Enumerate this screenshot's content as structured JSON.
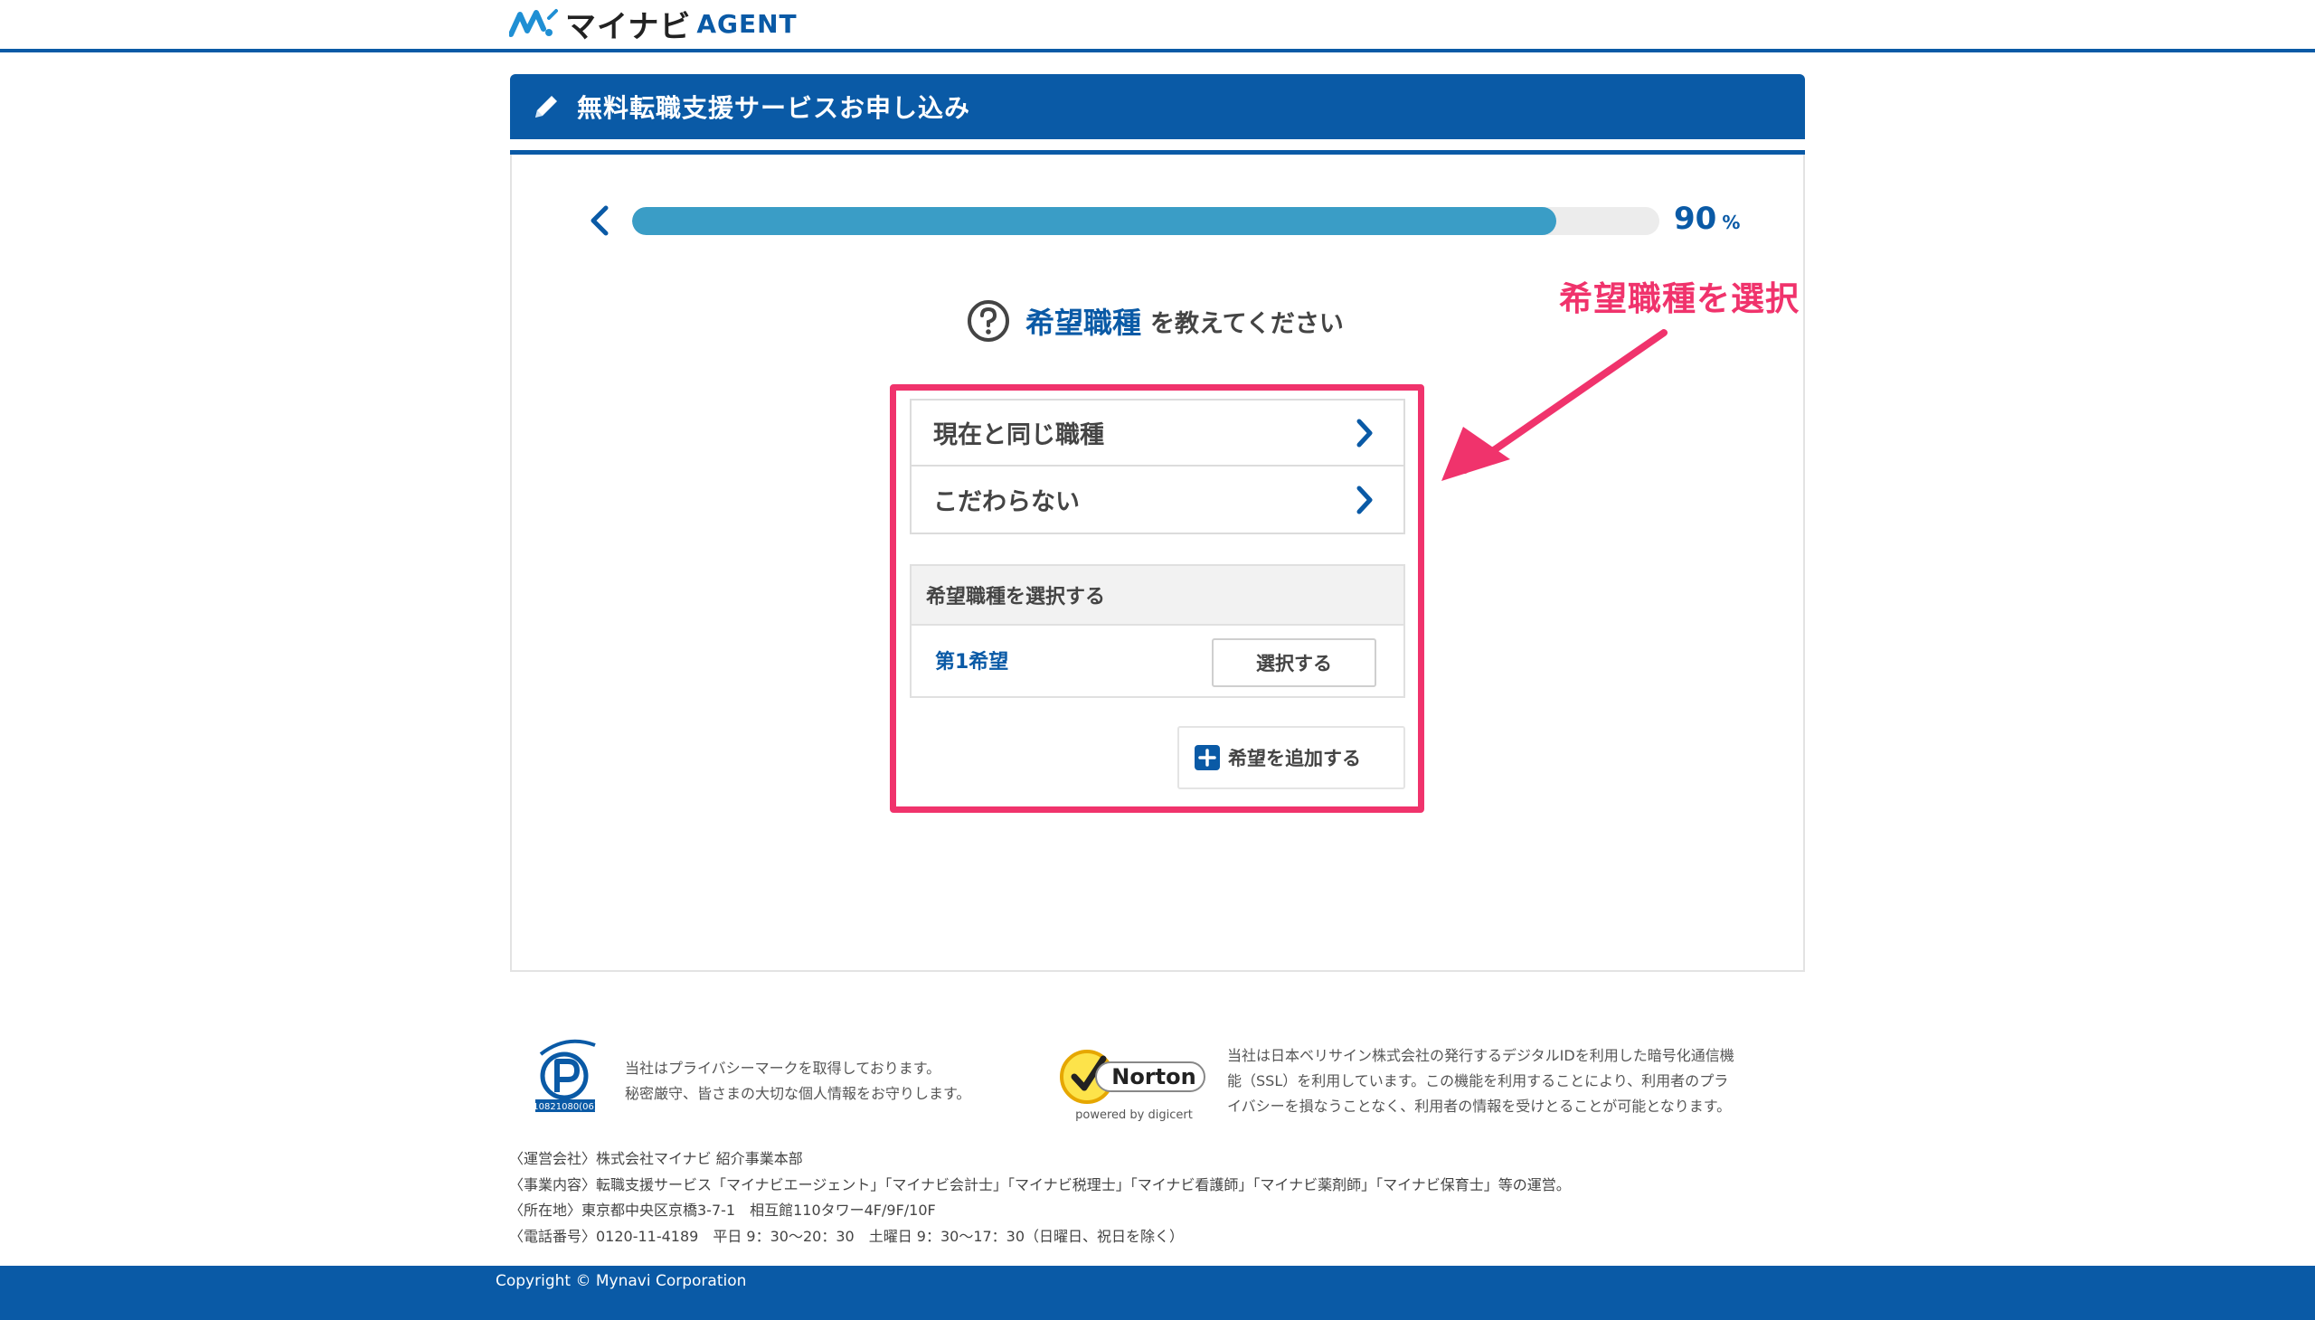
{
  "header": {
    "logo_main": "マイナビ",
    "logo_agent": "AGENT"
  },
  "title_bar": {
    "text": "無料転職支援サービスお申し込み",
    "icon": "pencil-icon"
  },
  "progress": {
    "value_percent": 90,
    "number": "90",
    "unit": "%",
    "back_icon": "chevron-left-icon"
  },
  "question": {
    "icon": "question-circle-icon",
    "highlight": "希望職種",
    "rest": "を教えてください"
  },
  "options": [
    {
      "label": "現在と同じ職種",
      "icon": "chevron-right-icon"
    },
    {
      "label": "こだわらない",
      "icon": "chevron-right-icon"
    }
  ],
  "select_section": {
    "heading": "希望職種を選択する",
    "choice_label": "第1希望",
    "select_button": "選択する",
    "add_button": "希望を追加する",
    "add_icon": "plus-square-icon"
  },
  "annotation": {
    "label": "希望職種を選択",
    "color": "#f0336c"
  },
  "footer": {
    "privacy_text_1": "当社はプライバシーマークを取得しております。",
    "privacy_text_2": "秘密厳守、皆さまの大切な個人情報をお守りします。",
    "privacy_mark_text": "10821080(06)",
    "ssl_text_1": "当社は日本ベリサイン株式会社の発行するデジタルIDを利用した暗号化通信機",
    "ssl_text_2": "能（SSL）を利用しています。この機能を利用することにより、利用者のプラ",
    "ssl_text_3": "イバシーを損なうことなく、利用者の情報を受けとることが可能となります。",
    "norton_brand": "Norton",
    "norton_sub": "powered by digicert",
    "company_lines": [
      "〈運営会社〉株式会社マイナビ 紹介事業本部",
      "〈事業内容〉転職支援サービス「マイナビエージェント」「マイナビ会計士」「マイナビ税理士」「マイナビ看護師」「マイナビ薬剤師」「マイナビ保育士」等の運営。",
      "〈所在地〉東京都中央区京橋3-7-1　相互館110タワー4F/9F/10F",
      "〈電話番号〉0120-11-4189　平日 9：30〜20：30　土曜日 9：30〜17：30（日曜日、祝日を除く）"
    ],
    "copyright": "Copyright © Mynavi Corporation"
  },
  "colors": {
    "brand_blue": "#0a5aa6",
    "progress_fill": "#3a9dc6",
    "annotation_pink": "#f0336c"
  }
}
